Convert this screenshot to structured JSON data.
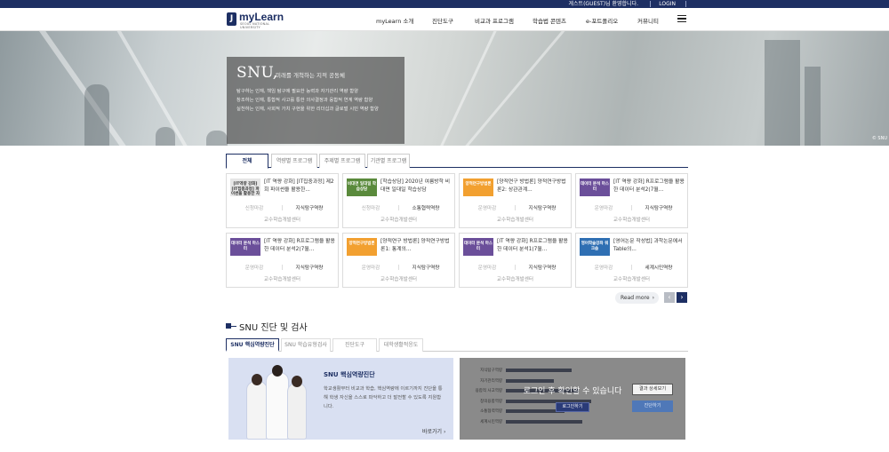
{
  "topbar": {
    "welcome": "게스트(GUEST)님 환영합니다.",
    "login": "LOGIN"
  },
  "header": {
    "logo_text": "myLearn",
    "logo_sub": "SEOUL NATIONAL UNIVERSITY",
    "menu": [
      "myLearn 소개",
      "진단도구",
      "비교과 프로그램",
      "학습법 콘텐츠",
      "e-포트폴리오",
      "커뮤니티"
    ]
  },
  "hero": {
    "title": "SNU,",
    "subtitle": "미래를 개척하는 지적 공동체",
    "lines": [
      "탐구하는 인재, 책임 탐구에 필요한 능력과 자기관리 역량 함양",
      "창조하는 인재, 통합적 사고를 통한 의사결정과 융합적 연계 역량 함양",
      "실천하는 인재, 사회적 가치 구현을 위한 리더십과 글로벌 시민 역량 함양"
    ],
    "credit": "© SNU"
  },
  "program_tabs": [
    "전체",
    "역량별 프로그램",
    "주제별 프로그램",
    "기관별 프로그램"
  ],
  "programs": [
    {
      "thumb": "[IT역량 강화] [IT집중과정] 파이썬을 활용한 자료 분석",
      "thumb_color": "#e6e6e6",
      "thumb_text_color": "#333333",
      "title": "[IT 역량 강화] [IT집중과정] 제2회 파이썬을 활용한...",
      "status": "신청마감",
      "category": "지식탐구역량",
      "org": "교수학습개발센터"
    },
    {
      "thumb": "비대면 일대일 학습상담",
      "thumb_color": "#5a8a3c",
      "thumb_text_color": "#ffffff",
      "title": "[학습상담] 2020년 여름방학 비대면 일대일 학습상담",
      "status": "신청마감",
      "category": "소통협력역량",
      "org": "교수학습개발센터"
    },
    {
      "thumb": "양적연구방법론",
      "thumb_color": "#f2a030",
      "thumb_text_color": "#ffffff",
      "title": "[양적연구 방법론] 양적연구방법론2: 상관관계...",
      "status": "운영마감",
      "category": "지식탐구역량",
      "org": "교수학습개발센터"
    },
    {
      "thumb": "데이터 분석 마스터",
      "thumb_color": "#6b4f9a",
      "thumb_text_color": "#ffffff",
      "title": "[IT 역량 강화] R프로그램을 활용한 데이터 분석2(7월...",
      "status": "운영마감",
      "category": "지식탐구역량",
      "org": "교수학습개발센터"
    },
    {
      "thumb": "데이터 분석 마스터",
      "thumb_color": "#6b4f9a",
      "thumb_text_color": "#ffffff",
      "title": "[IT 역량 강화] R프로그램을 활용한 데이터 분석2(7월...",
      "status": "운영마감",
      "category": "지식탐구역량",
      "org": "교수학습개발센터"
    },
    {
      "thumb": "양적연구방법론",
      "thumb_color": "#f2a030",
      "thumb_text_color": "#ffffff",
      "title": "[양적연구 방법론] 양적연구방법론1: 통계의...",
      "status": "운영마감",
      "category": "지식탐구역량",
      "org": "교수학습개발센터"
    },
    {
      "thumb": "데이터 분석 마스터",
      "thumb_color": "#6b4f9a",
      "thumb_text_color": "#ffffff",
      "title": "[IT 역량 강화] R프로그램을 활용한 데이터 분석1(7월...",
      "status": "운영마감",
      "category": "지식탐구역량",
      "org": "교수학습개발센터"
    },
    {
      "thumb": "영어학술강좌 워크숍",
      "thumb_color": "#2f6fb3",
      "thumb_text_color": "#ffffff",
      "title": "[영어논문 작성법] 과학논문에서 Table의...",
      "status": "운영마감",
      "category": "세계시민역량",
      "org": "교수학습개발센터"
    }
  ],
  "readmore": "Read more",
  "diagnosis": {
    "section_title": "SNU 진단 및 검사",
    "tabs": [
      "SNU 핵심역량진단",
      "SNU 학습유형검사",
      "진단도구",
      "대학생활적응도"
    ],
    "card_title": "SNU 핵심역량진단",
    "card_desc": "학교생활부터 비교과 학습, 핵심역량에 이르기까지 진단을 통해 학생 자신을 스스로 파악하고 더 발전할 수 있도록 지원합니다.",
    "go": "바로가기",
    "bars": [
      {
        "label": "지식탐구역량",
        "value": 0.62
      },
      {
        "label": "자기관리역량",
        "value": 0.45
      },
      {
        "label": "융합적 사고역량",
        "value": 0.68
      },
      {
        "label": "창의융합역량",
        "value": 0.8
      },
      {
        "label": "소통협력역량",
        "value": 0.55
      },
      {
        "label": "세계시민역량",
        "value": 0.72
      }
    ],
    "overlay": "로그인 후 확인할 수 있습니다",
    "login_btn": "로그인하기",
    "result_btn": "결과 상세보기",
    "start_btn": "진단하기"
  },
  "colors": {
    "brand": "#1d2f63",
    "accent": "#4f78b8"
  }
}
